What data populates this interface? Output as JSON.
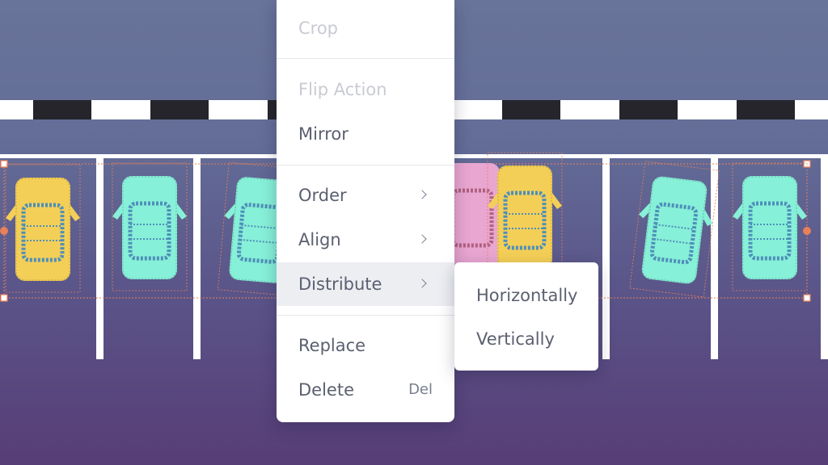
{
  "scene": {
    "colors": {
      "curb_black": "#25252b",
      "lines": "#ffffff",
      "yellow_car": "#f4cf57",
      "teal_car": "#87f0d8",
      "pink_car": "#e9a6d1",
      "selection": "#e8805a"
    },
    "icons": [
      "yellow-car-icon",
      "teal-car-icon",
      "pink-car-icon"
    ]
  },
  "context_menu": {
    "crop": "Crop",
    "flip_action": "Flip Action",
    "mirror": "Mirror",
    "order": "Order",
    "align": "Align",
    "distribute": "Distribute",
    "replace": "Replace",
    "delete": "Delete",
    "delete_shortcut": "Del"
  },
  "submenu": {
    "horizontally": "Horizontally",
    "vertically": "Vertically"
  }
}
